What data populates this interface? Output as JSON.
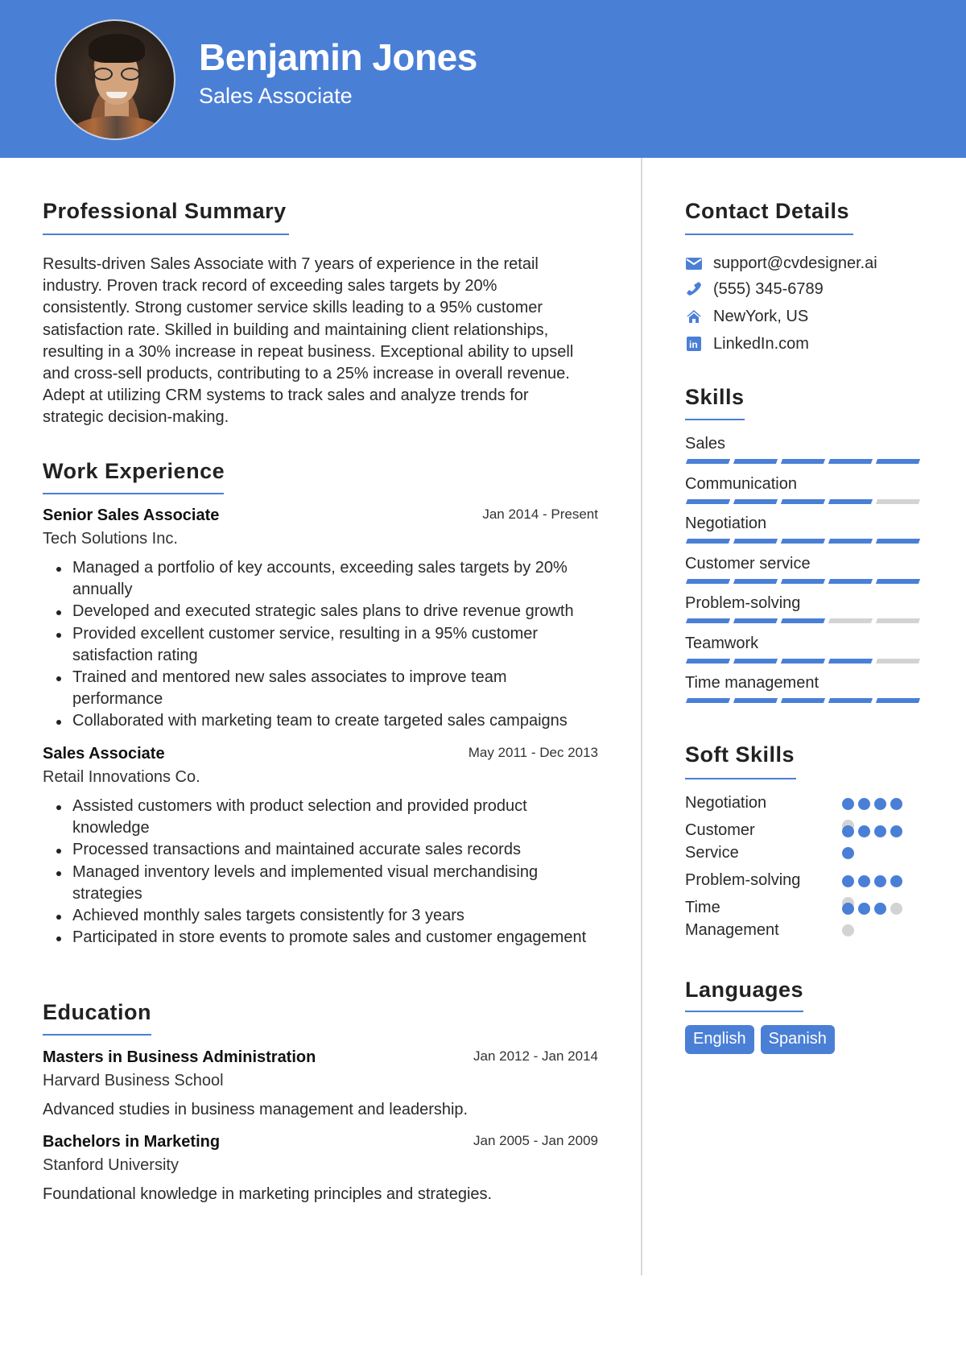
{
  "header": {
    "name": "Benjamin Jones",
    "title": "Sales Associate",
    "accent_color": "#4a7fd6"
  },
  "sections": {
    "summary": "Professional Summary",
    "work": "Work Experience",
    "education": "Education",
    "contact": "Contact Details",
    "skills": "Skills",
    "soft_skills": "Soft Skills",
    "languages": "Languages"
  },
  "summary": {
    "lines": [
      "Results-driven Sales Associate with 7 years of experience in the retail",
      "industry. Proven track record of exceeding sales targets by 20%",
      "consistently. Strong customer service skills leading to a 95% customer",
      "satisfaction rate. Skilled in building and maintaining client relationships,",
      "resulting in a 30% increase in repeat business. Exceptional ability to upsell",
      "and cross-sell products, contributing to a 25% increase in overall revenue.",
      "Adept at utilizing CRM systems to track sales and analyze trends for",
      "strategic decision-making."
    ]
  },
  "work": [
    {
      "title": "Senior Sales Associate",
      "date": "Jan 2014 - Present",
      "company": "Tech Solutions Inc.",
      "bullets": [
        "Managed a portfolio of key accounts, exceeding sales targets by 20% annually",
        "Developed and executed strategic sales plans to drive revenue growth",
        "Provided excellent customer service, resulting in a 95% customer satisfaction rating",
        "Trained and mentored new sales associates to improve team performance",
        "Collaborated with marketing team to create targeted sales campaigns"
      ]
    },
    {
      "title": "Sales Associate",
      "date": "May 2011 - Dec 2013",
      "company": "Retail Innovations Co.",
      "bullets": [
        "Assisted customers with product selection and provided product knowledge",
        "Processed transactions and maintained accurate sales records",
        "Managed inventory levels and implemented visual merchandising strategies",
        "Achieved monthly sales targets consistently for 3 years",
        "Participated in store events to promote sales and customer engagement"
      ]
    }
  ],
  "education": [
    {
      "degree": "Masters in Business Administration",
      "date": "Jan 2012 - Jan 2014",
      "school": "Harvard Business School",
      "description": "Advanced studies in business management and leadership."
    },
    {
      "degree": "Bachelors in Marketing",
      "date": "Jan 2005 - Jan 2009",
      "school": "Stanford University",
      "description": "Foundational knowledge in marketing principles and strategies."
    }
  ],
  "contact": [
    {
      "icon": "envelope-icon",
      "text": "support@cvdesigner.ai"
    },
    {
      "icon": "phone-icon",
      "text": "(555) 345-6789"
    },
    {
      "icon": "home-icon",
      "text": "NewYork, US"
    },
    {
      "icon": "linkedin-icon",
      "text": "LinkedIn.com"
    }
  ],
  "skills": [
    {
      "name": "Sales",
      "level": 5,
      "max": 5
    },
    {
      "name": "Communication",
      "level": 4,
      "max": 5
    },
    {
      "name": "Negotiation",
      "level": 5,
      "max": 5
    },
    {
      "name": "Customer service",
      "level": 5,
      "max": 5
    },
    {
      "name": "Problem-solving",
      "level": 3,
      "max": 5
    },
    {
      "name": "Teamwork",
      "level": 4,
      "max": 5
    },
    {
      "name": "Time management",
      "level": 5,
      "max": 5
    }
  ],
  "soft_skills": [
    {
      "name": "Negotiation",
      "level": 4,
      "max": 5
    },
    {
      "name": "Customer Service",
      "level": 5,
      "max": 5
    },
    {
      "name": "Problem-solving",
      "level": 4,
      "max": 5
    },
    {
      "name": "Time Management",
      "level": 3,
      "max": 5
    }
  ],
  "languages": [
    "English",
    "Spanish"
  ]
}
